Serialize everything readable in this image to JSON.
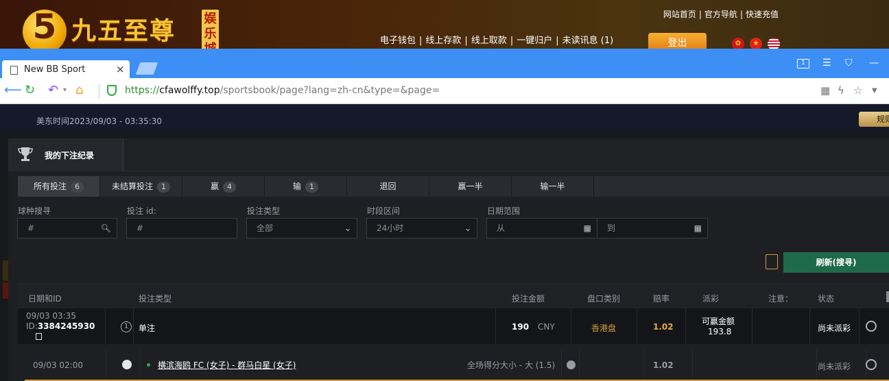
{
  "site": {
    "logo_digit": "5",
    "logo_text": "九五至尊",
    "logo_badge": "娱乐城",
    "top_links": [
      "网站首页",
      "官方导航",
      "快速充值"
    ],
    "main_links": [
      "电子钱包",
      "线上存款",
      "线上取款",
      "一键归户",
      "未读讯息 (1)"
    ],
    "logout": "登出"
  },
  "browser": {
    "tab_title": "New BB Sport",
    "tab_close": "×",
    "url_proto": "https://",
    "url_host": "cfawolffy.top",
    "url_path": "/sportsbook/page?lang=zh-cn&type=&page=",
    "win_ctrl_tab": "1"
  },
  "page": {
    "time": "美东时间2023/09/03 - 03:35:30",
    "rules_btn": "规则",
    "panel_title": "我的下注纪录",
    "filter_tabs": [
      {
        "label": "所有投注",
        "count": "6"
      },
      {
        "label": "未结算投注",
        "count": "1"
      },
      {
        "label": "赢",
        "count": "4"
      },
      {
        "label": "输",
        "count": "1"
      },
      {
        "label": "退回",
        "count": ""
      },
      {
        "label": "赢一半",
        "count": ""
      },
      {
        "label": "输一半",
        "count": ""
      }
    ],
    "filters": {
      "sport_label": "球种搜寻",
      "sport_placeholder": "#",
      "betid_label": "投注 id:",
      "betid_placeholder": "#",
      "bettype_label": "投注类型",
      "bettype_value": "全部",
      "period_label": "时段区间",
      "period_value": "24小时",
      "date_label": "日期范围",
      "date_from": "从",
      "date_to": "到"
    },
    "refresh_btn": "刷新(搜寻)",
    "table_headers": [
      "日期和ID",
      "投注类型",
      "投注金额",
      "盘口类别",
      "赔率",
      "派彩",
      "注意：",
      "状态"
    ],
    "bet": {
      "date": "09/03 03:35",
      "id_prefix": "ID:",
      "id": "3384245930",
      "count": "1",
      "type": "单注",
      "amount": "190",
      "currency": "CNY",
      "market": "香港盘",
      "odds": "1.02",
      "payout_label": "可赢金额",
      "payout_value": "193.8",
      "status": "尚未派彩"
    },
    "leg": {
      "date": "09/03 02:00",
      "match": "横滨海鸥 FC (女子) - 群马白星 (女子)",
      "selection": "全场得分大小 - 大 (1.5)",
      "odds": "1.02",
      "status": "尚未派彩"
    }
  }
}
